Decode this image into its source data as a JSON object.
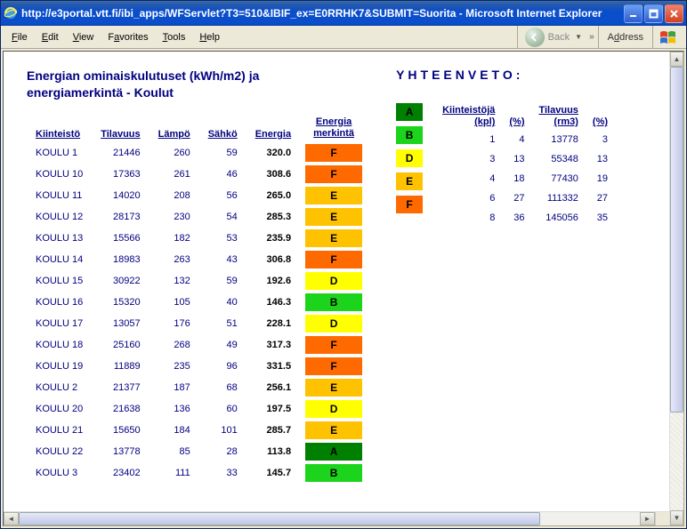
{
  "window": {
    "title": "http://e3portal.vtt.fi/ibi_apps/WFServlet?T3=510&IBIF_ex=E0RRHK7&SUBMIT=Suorita - Microsoft Internet Explorer"
  },
  "menubar": {
    "file": "File",
    "edit": "Edit",
    "view": "View",
    "favorites": "Favorites",
    "tools": "Tools",
    "help": "Help",
    "back": "Back",
    "address": "Address"
  },
  "page": {
    "title_l1": "Energian ominaiskulutuset (kWh/m2) ja",
    "title_l2": "energiamerkintä - Koulut",
    "summary_heading": "YHTEENVETO:"
  },
  "table": {
    "headers": {
      "kiinteisto": "Kiinteistö",
      "tilavuus": "Tilavuus",
      "lampo": "Lämpö",
      "sahko": "Sähkö",
      "energia": "Energia",
      "merkinta_l1": "Energia",
      "merkinta_l2": "merkintä"
    },
    "rows": [
      {
        "name": "KOULU 1",
        "til": "21446",
        "lampo": "260",
        "sahko": "59",
        "energia": "320.0",
        "label": "F"
      },
      {
        "name": "KOULU 10",
        "til": "17363",
        "lampo": "261",
        "sahko": "46",
        "energia": "308.6",
        "label": "F"
      },
      {
        "name": "KOULU 11",
        "til": "14020",
        "lampo": "208",
        "sahko": "56",
        "energia": "265.0",
        "label": "E"
      },
      {
        "name": "KOULU 12",
        "til": "28173",
        "lampo": "230",
        "sahko": "54",
        "energia": "285.3",
        "label": "E"
      },
      {
        "name": "KOULU 13",
        "til": "15566",
        "lampo": "182",
        "sahko": "53",
        "energia": "235.9",
        "label": "E"
      },
      {
        "name": "KOULU 14",
        "til": "18983",
        "lampo": "263",
        "sahko": "43",
        "energia": "306.8",
        "label": "F"
      },
      {
        "name": "KOULU 15",
        "til": "30922",
        "lampo": "132",
        "sahko": "59",
        "energia": "192.6",
        "label": "D"
      },
      {
        "name": "KOULU 16",
        "til": "15320",
        "lampo": "105",
        "sahko": "40",
        "energia": "146.3",
        "label": "B"
      },
      {
        "name": "KOULU 17",
        "til": "13057",
        "lampo": "176",
        "sahko": "51",
        "energia": "228.1",
        "label": "D"
      },
      {
        "name": "KOULU 18",
        "til": "25160",
        "lampo": "268",
        "sahko": "49",
        "energia": "317.3",
        "label": "F"
      },
      {
        "name": "KOULU 19",
        "til": "11889",
        "lampo": "235",
        "sahko": "96",
        "energia": "331.5",
        "label": "F"
      },
      {
        "name": "KOULU 2",
        "til": "21377",
        "lampo": "187",
        "sahko": "68",
        "energia": "256.1",
        "label": "E"
      },
      {
        "name": "KOULU 20",
        "til": "21638",
        "lampo": "136",
        "sahko": "60",
        "energia": "197.5",
        "label": "D"
      },
      {
        "name": "KOULU 21",
        "til": "15650",
        "lampo": "184",
        "sahko": "101",
        "energia": "285.7",
        "label": "E"
      },
      {
        "name": "KOULU 22",
        "til": "13778",
        "lampo": "85",
        "sahko": "28",
        "energia": "113.8",
        "label": "A"
      },
      {
        "name": "KOULU 3",
        "til": "23402",
        "lampo": "111",
        "sahko": "33",
        "energia": "145.7",
        "label": "B"
      }
    ]
  },
  "colors": {
    "A": "#008000",
    "B": "#1cd41c",
    "C": "#9be462",
    "D": "#ffff00",
    "E": "#ffc200",
    "F": "#ff6a00",
    "G": "#ff0000"
  },
  "legend": [
    "A",
    "B",
    "D",
    "E",
    "F"
  ],
  "summary": {
    "headers": {
      "kpl_l1": "Kiinteistöjä",
      "kpl_l2": "(kpl)",
      "pct": "(%)",
      "til_l1": "Tilavuus",
      "til_l2": "(rm3)",
      "pct2": "(%)"
    },
    "rows": [
      {
        "kpl": "1",
        "pct": "4",
        "til": "13778",
        "pct2": "3"
      },
      {
        "kpl": "3",
        "pct": "13",
        "til": "55348",
        "pct2": "13"
      },
      {
        "kpl": "4",
        "pct": "18",
        "til": "77430",
        "pct2": "19"
      },
      {
        "kpl": "6",
        "pct": "27",
        "til": "111332",
        "pct2": "27"
      },
      {
        "kpl": "8",
        "pct": "36",
        "til": "145056",
        "pct2": "35"
      }
    ]
  }
}
